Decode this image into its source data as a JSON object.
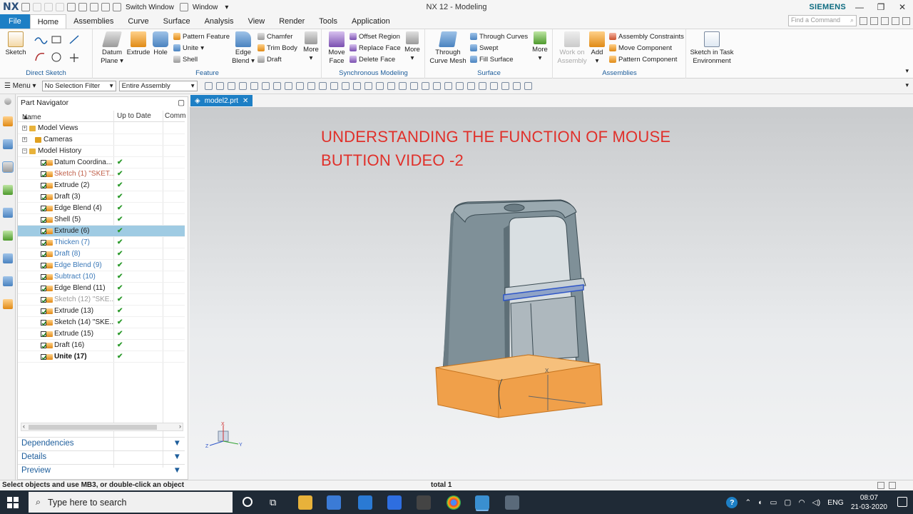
{
  "titlebar": {
    "logo": "NX",
    "switch_window": "Switch Window",
    "window_menu": "Window",
    "title": "NX 12 - Modeling",
    "brand": "SIEMENS",
    "minimize": "—",
    "restore": "❐",
    "close": "✕"
  },
  "tabs": [
    "File",
    "Home",
    "Assemblies",
    "Curve",
    "Surface",
    "Analysis",
    "View",
    "Render",
    "Tools",
    "Application"
  ],
  "active_tab": "Home",
  "command_search_placeholder": "Find a Command",
  "ribbon": {
    "direct_sketch": {
      "label": "Direct Sketch",
      "sketch": "Sketch"
    },
    "feature": {
      "label": "Feature",
      "datum_plane": "Datum Plane",
      "extrude": "Extrude",
      "hole": "Hole",
      "pattern_feature": "Pattern Feature",
      "unite": "Unite",
      "shell": "Shell",
      "edge_blend": "Edge Blend",
      "chamfer": "Chamfer",
      "trim_body": "Trim Body",
      "draft": "Draft",
      "more": "More"
    },
    "sync": {
      "label": "Synchronous Modeling",
      "move_face": "Move Face",
      "offset_region": "Offset Region",
      "replace_face": "Replace Face",
      "delete_face": "Delete Face",
      "more": "More"
    },
    "surface": {
      "label": "Surface",
      "through_curve_mesh": "Through Curve Mesh",
      "through_curves": "Through Curves",
      "swept": "Swept",
      "fill_surface": "Fill Surface",
      "more": "More"
    },
    "assemblies": {
      "label": "Assemblies",
      "work_on_assembly": "Work on Assembly",
      "add": "Add",
      "assembly_constraints": "Assembly Constraints",
      "move_component": "Move Component",
      "pattern_component": "Pattern Component"
    },
    "sketch_task": "Sketch in Task Environment"
  },
  "toolbar": {
    "menu": "Menu",
    "selection_filter": "No Selection Filter",
    "scope": "Entire Assembly"
  },
  "navigator": {
    "title": "Part Navigator",
    "col_name": "Name",
    "col_uptodate": "Up to Date",
    "col_comment": "Comm",
    "rows": [
      {
        "name": "Model Views",
        "level": 0,
        "check": false,
        "uptodate": "",
        "color": "#222"
      },
      {
        "name": "Cameras",
        "level": 0,
        "check": false,
        "uptodate": "",
        "color": "#222"
      },
      {
        "name": "Model History",
        "level": 0,
        "check": false,
        "uptodate": "",
        "color": "#222"
      },
      {
        "name": "Datum Coordina...",
        "level": 1,
        "check": true,
        "uptodate": "✔",
        "color": "#222"
      },
      {
        "name": "Sketch (1) \"SKET...",
        "level": 1,
        "check": true,
        "uptodate": "✔",
        "color": "#c0604a"
      },
      {
        "name": "Extrude (2)",
        "level": 1,
        "check": true,
        "uptodate": "✔",
        "color": "#222"
      },
      {
        "name": "Draft (3)",
        "level": 1,
        "check": true,
        "uptodate": "✔",
        "color": "#222"
      },
      {
        "name": "Edge Blend (4)",
        "level": 1,
        "check": true,
        "uptodate": "✔",
        "color": "#222"
      },
      {
        "name": "Shell (5)",
        "level": 1,
        "check": true,
        "uptodate": "✔",
        "color": "#222"
      },
      {
        "name": "Extrude (6)",
        "level": 1,
        "check": true,
        "uptodate": "✔",
        "color": "#222"
      },
      {
        "name": "Thicken (7)",
        "level": 1,
        "check": true,
        "uptodate": "✔",
        "color": "#3a78b8"
      },
      {
        "name": "Draft (8)",
        "level": 1,
        "check": true,
        "uptodate": "✔",
        "color": "#3a78b8"
      },
      {
        "name": "Edge Blend (9)",
        "level": 1,
        "check": true,
        "uptodate": "✔",
        "color": "#3a78b8"
      },
      {
        "name": "Subtract (10)",
        "level": 1,
        "check": true,
        "uptodate": "✔",
        "color": "#3a78b8"
      },
      {
        "name": "Edge Blend (11)",
        "level": 1,
        "check": true,
        "uptodate": "✔",
        "color": "#222"
      },
      {
        "name": "Sketch (12) \"SKE...",
        "level": 1,
        "check": true,
        "uptodate": "✔",
        "color": "#999"
      },
      {
        "name": "Extrude (13)",
        "level": 1,
        "check": true,
        "uptodate": "✔",
        "color": "#222"
      },
      {
        "name": "Sketch (14) \"SKE...",
        "level": 1,
        "check": true,
        "uptodate": "✔",
        "color": "#222"
      },
      {
        "name": "Extrude (15)",
        "level": 1,
        "check": true,
        "uptodate": "✔",
        "color": "#222"
      },
      {
        "name": "Draft (16)",
        "level": 1,
        "check": true,
        "uptodate": "✔",
        "color": "#222"
      },
      {
        "name": "Unite (17)",
        "level": 1,
        "check": true,
        "uptodate": "✔",
        "color": "#111"
      }
    ],
    "selected_row": "Extrude (6)",
    "sections": [
      "Dependencies",
      "Details",
      "Preview"
    ]
  },
  "document_tab": "model2.prt",
  "overlay_title_line1": "UNDERSTANDING THE FUNCTION OF MOUSE",
  "overlay_title_line2": "BUTTION VIDEO -2",
  "triad": {
    "x": "Y",
    "y": "X",
    "z": "Z"
  },
  "status": {
    "message": "Select objects and use MB3, or double-click an object",
    "count": "total 1"
  },
  "taskbar": {
    "search_placeholder": "Type here to search",
    "language": "ENG",
    "time": "08:07",
    "date": "21-03-2020"
  }
}
